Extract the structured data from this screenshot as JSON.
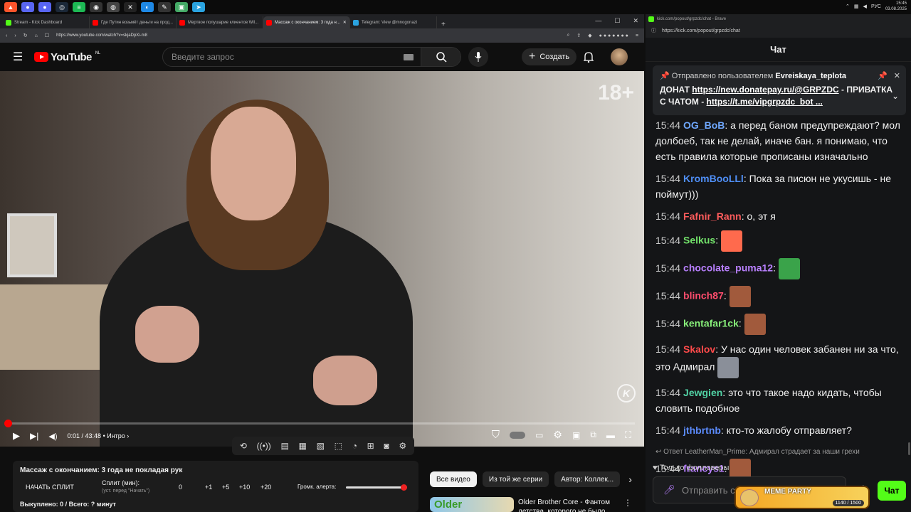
{
  "taskbar": {
    "lang": "РУС",
    "time": "15:45",
    "date": "03.08.2025",
    "apps": [
      "brave",
      "discord",
      "discord",
      "steam",
      "spotify",
      "obs",
      "chrome",
      "epic",
      "vpn",
      "telegram",
      "app",
      "app"
    ]
  },
  "browser": {
    "tabs": [
      {
        "label": "Stream - Kick Dashboard",
        "color": "#53fc18"
      },
      {
        "label": "Где Путин возьмёт деньги на прод...",
        "color": "#ff0000"
      },
      {
        "label": "Мертвое полушарие клиентов Wil...",
        "color": "#ff0000"
      },
      {
        "label": "Массаж с окончанием: 3 года н...",
        "color": "#ff0000",
        "active": true
      },
      {
        "label": "Telegram: View @mnogonazi",
        "color": "#2aa3e0"
      }
    ],
    "url": "https://www.youtube.com/watch?v=skjaDpXi-m8"
  },
  "youtube": {
    "logo_text": "YouTube",
    "region": "NL",
    "search_placeholder": "Введите запрос",
    "create_label": "Создать",
    "age_rating": "18+",
    "watermark": "K",
    "time_current": "0:01",
    "time_total": "43:48",
    "chapter": "Интро",
    "progress_fraction": 0.001
  },
  "split": {
    "title": "Массаж с окончанием: 3 года не покладая рук",
    "start_label": "НАЧАТЬ СПЛИТ",
    "split_label": "Сплит (мин):",
    "split_hint": "(уст. перед \"Начать\")",
    "split_value": "0",
    "inc_1": "+1",
    "inc_5": "+5",
    "inc_10": "+10",
    "inc_20": "+20",
    "volume_label": "Громк. алерта:",
    "volume_fraction": 1.0,
    "status": "Выкуплено: 0 / Всего: ? минут"
  },
  "chips": [
    "Все видео",
    "Из той же серии",
    "Автор: Коллек..."
  ],
  "recommendation": {
    "thumb_text": "Older",
    "title": "Older Brother Core - Фантом детства, которого не было"
  },
  "chat": {
    "window_title": "kick.com/popout/grpzdc/chat - Brave",
    "url": "https://kick.com/popout/grpzdc/chat",
    "header": "Чат",
    "pinned_by_label": "Отправлено пользователем",
    "pinned_by": "Evreiskaya_teplota",
    "pinned_line1_prefix": "ДОНАТ",
    "pinned_link1": "https://new.donatepay.ru/@GRPZDC",
    "pinned_line2_prefix": "- ПРИВАТКА С ЧАТОМ -",
    "pinned_link2": "https://t.me/vipgrpzdc_bot ...",
    "messages": [
      {
        "time": "15:44",
        "user": "OG_BoB",
        "color": "#6fa8ff",
        "text": "а перед баном предупреждают? мол долбоеб, так не делай, иначе бан. я понимаю, что есть правила которые прописаны изначально"
      },
      {
        "time": "15:44",
        "user": "KromBooLLl",
        "color": "#4f8ff7",
        "text": "Пока за писюн не укусишь - не поймут)))"
      },
      {
        "time": "15:44",
        "user": "Fafnir_Rann",
        "color": "#ff5c5c",
        "text": "о, эт я"
      },
      {
        "time": "15:44",
        "user": "Selkus",
        "color": "#72e26a",
        "text": "",
        "emote": "#ff6a4d"
      },
      {
        "time": "15:44",
        "user": "chocolate_puma12",
        "color": "#b980ff",
        "text": "",
        "emote": "#3aa34a"
      },
      {
        "time": "15:44",
        "user": "blinch87",
        "color": "#ff4d6d",
        "text": "",
        "emote": "#a15a3c"
      },
      {
        "time": "15:44",
        "user": "kentafar1ck",
        "color": "#88f07a",
        "text": "",
        "emote": "#a15a3c"
      },
      {
        "time": "15:44",
        "user": "Skalov",
        "color": "#ff4a4a",
        "text": "У нас один человек забанен ни за что, это Адмирал",
        "emote": "#8a8f99"
      },
      {
        "time": "15:44",
        "user": "Jewgien",
        "color": "#51d1a4",
        "text": "это что такое надо кидать, чтобы словить подобное"
      },
      {
        "time": "15:44",
        "user": "jthbrtnb",
        "color": "#5c8cff",
        "text": "кто-то жалобу отправляет?"
      },
      {
        "time": "15:44",
        "user": "francys1",
        "color": "#b980ff",
        "text": "",
        "emote": "#a15a3c",
        "reply": "Ответ LeatherMan_Prime: Адмирал страдает за наши грехи"
      }
    ],
    "followers_only": "Только фолловеры",
    "input_placeholder": "Отправить со...",
    "send_label": "Чат",
    "meme_title": "MEME PARTY",
    "meme_count": "1140 / 1500"
  }
}
